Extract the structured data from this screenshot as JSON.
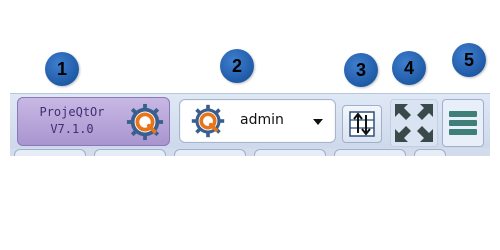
{
  "callouts": [
    "1",
    "2",
    "3",
    "4",
    "5"
  ],
  "version": {
    "name": "ProjeQtOr",
    "number": "V7.1.0"
  },
  "user": {
    "name": "admin"
  },
  "icons": {
    "logo": "projeqtor-gear-icon",
    "user_avatar": "projeqtor-gear-icon",
    "caret": "chevron-down-icon",
    "switch": "sort-arrows-icon",
    "fullscreen": "fullscreen-icon",
    "menu": "hamburger-menu-icon"
  },
  "colors": {
    "callout": "#1f5aa6",
    "version_bg": "#b9a7da",
    "version_text": "#3e2f72",
    "gear_orange": "#e8751a",
    "gear_blue": "#1f5aa6",
    "menu_teal": "#3f7f7a"
  }
}
